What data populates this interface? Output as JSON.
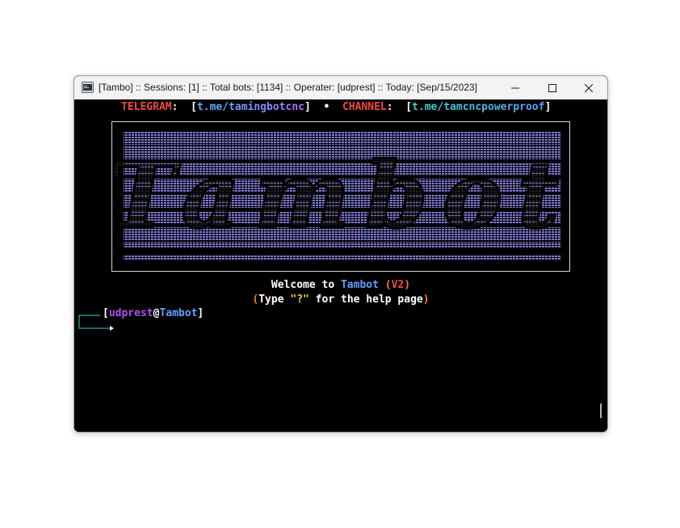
{
  "window": {
    "title": "[Tambo] :: Sessions: [1] :: Total bots: [1134] :: Operater: [udprest] :: Today: [Sep/15/2023]"
  },
  "banner": {
    "telegram_label": "TELEGRAM",
    "telegram_link": "t.me/tamingbotcnc",
    "bullet": "•",
    "channel_label": "CHANNEL",
    "channel_link": "t.me/tamcncpowerproof"
  },
  "logo": {
    "text": "Tambot"
  },
  "welcome": {
    "prefix": "Welcome to ",
    "name": "Tambot",
    "version": "V2",
    "help_prefix": "Type ",
    "help_key": "\"?\"",
    "help_suffix": " for the help page"
  },
  "prompt": {
    "user": "udprest",
    "at": "@",
    "host": "Tambot"
  },
  "colors": {
    "label_red": "#f04a3e",
    "link_blue": "#5fa0ff",
    "purple": "#b050f0",
    "cyan": "#35d4d4"
  }
}
